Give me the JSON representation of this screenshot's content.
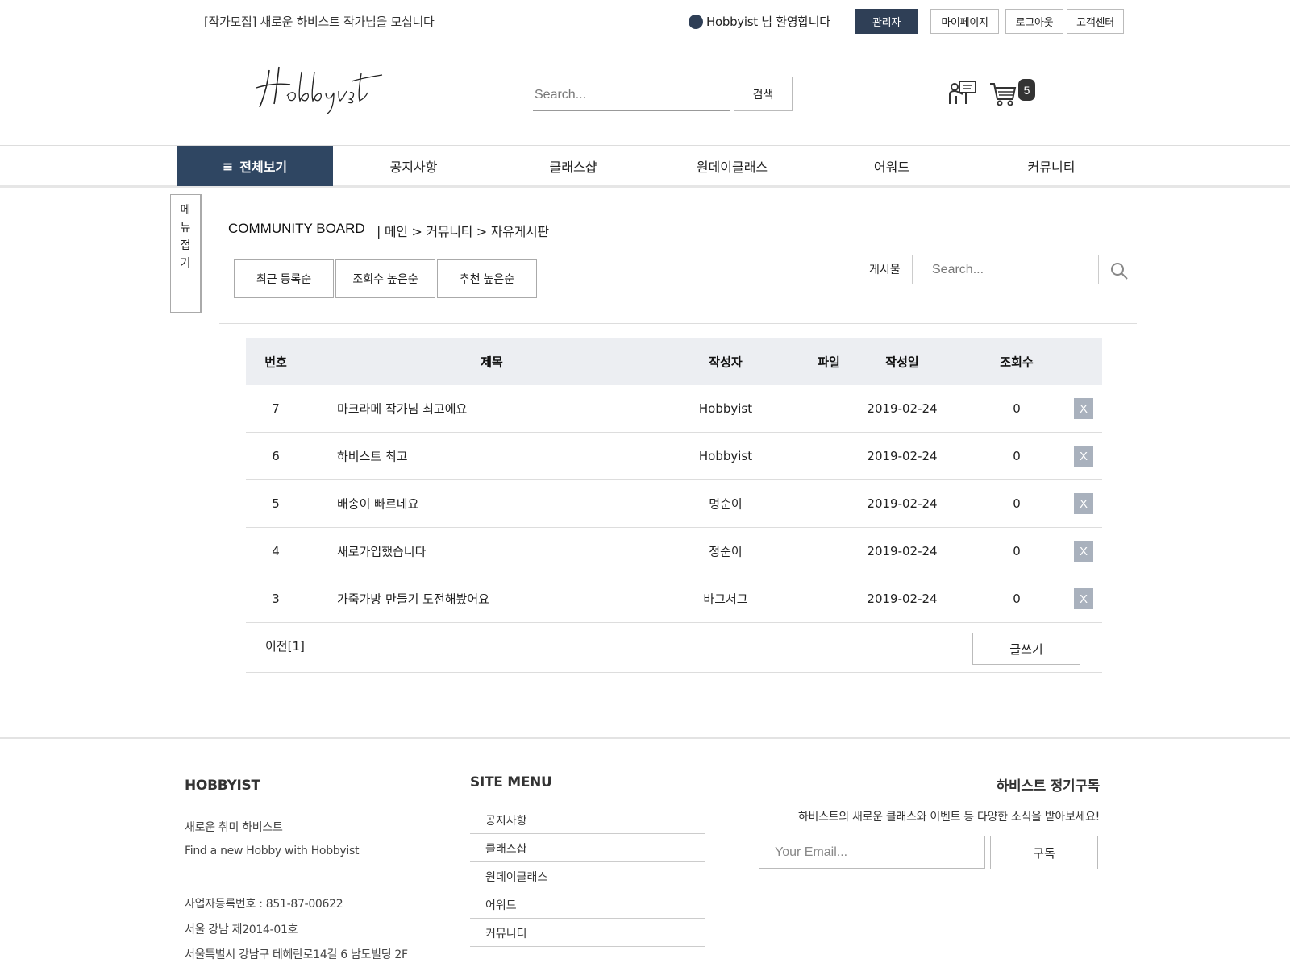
{
  "topbar": {
    "recruit_notice": "[작가모집] 새로운 하비스트 작가님을 모십니다",
    "welcome_text": "Hobbyist 님 환영합니다",
    "admin_label": "관리자",
    "mypage_label": "마이페이지",
    "logout_label": "로그아웃",
    "support_label": "고객센터"
  },
  "header": {
    "logo_text": "Hobbyist",
    "search_placeholder": "Search...",
    "search_button": "검색",
    "cart_count": "5"
  },
  "nav": {
    "all_label": "전체보기",
    "items": [
      "공지사항",
      "클래스샵",
      "원데이클래스",
      "어워드",
      "커뮤니티"
    ]
  },
  "side": {
    "collapse_chars": [
      "메",
      "뉴",
      "접",
      "기"
    ]
  },
  "board": {
    "title": "COMMUNITY BOARD",
    "breadcrumb": "|  메인 > 커뮤니티 > 자유게시판",
    "sort_buttons": [
      "최근 등록순",
      "조회수 높은순",
      "추천 높은순"
    ],
    "search_label": "게시물",
    "search_placeholder": "Search...",
    "columns": [
      "번호",
      "제목",
      "작성자",
      "파일",
      "작성일",
      "조회수"
    ],
    "rows": [
      {
        "num": "7",
        "title": "마크라메 작가님 최고에요",
        "author": "Hobbyist",
        "date": "2019-02-24",
        "views": "0"
      },
      {
        "num": "6",
        "title": "하비스트 최고",
        "author": "Hobbyist",
        "date": "2019-02-24",
        "views": "0"
      },
      {
        "num": "5",
        "title": "배송이 빠르네요",
        "author": "멍순이",
        "date": "2019-02-24",
        "views": "0"
      },
      {
        "num": "4",
        "title": "새로가입했습니다",
        "author": "정순이",
        "date": "2019-02-24",
        "views": "0"
      },
      {
        "num": "3",
        "title": "가죽가방 만들기 도전해봤어요",
        "author": "바그서그",
        "date": "2019-02-24",
        "views": "0"
      }
    ],
    "delete_label": "X",
    "prev_label": "이전[1]",
    "write_label": "글쓰기"
  },
  "footer": {
    "brand": "HOBBYIST",
    "tagline_ko": "새로운 취미 하비스트",
    "tagline_en": "Find a new Hobby with Hobbyist",
    "biz_number": "사업자등록번호 : 851-87-00622",
    "license": "서울 강남 제2014-01호",
    "address": "서울특별시 강남구 테헤란로14길 6 남도빌딩 2F",
    "site_menu_title": "SITE MENU",
    "site_menu": [
      "공지사항",
      "클래스샵",
      "원데이클래스",
      "어워드",
      "커뮤니티"
    ],
    "subscribe_title": "하비스트 정기구독",
    "subscribe_text": "하비스트의 새로운 클래스와 이벤트 등 다양한 소식을 받아보세요!",
    "email_placeholder": "Your Email...",
    "subscribe_button": "구독"
  },
  "colors": {
    "primary_navy": "#2f4662",
    "admin_navy": "#2f3f56",
    "table_header_bg": "#eceef2",
    "delete_button": "#a9b1bd"
  }
}
